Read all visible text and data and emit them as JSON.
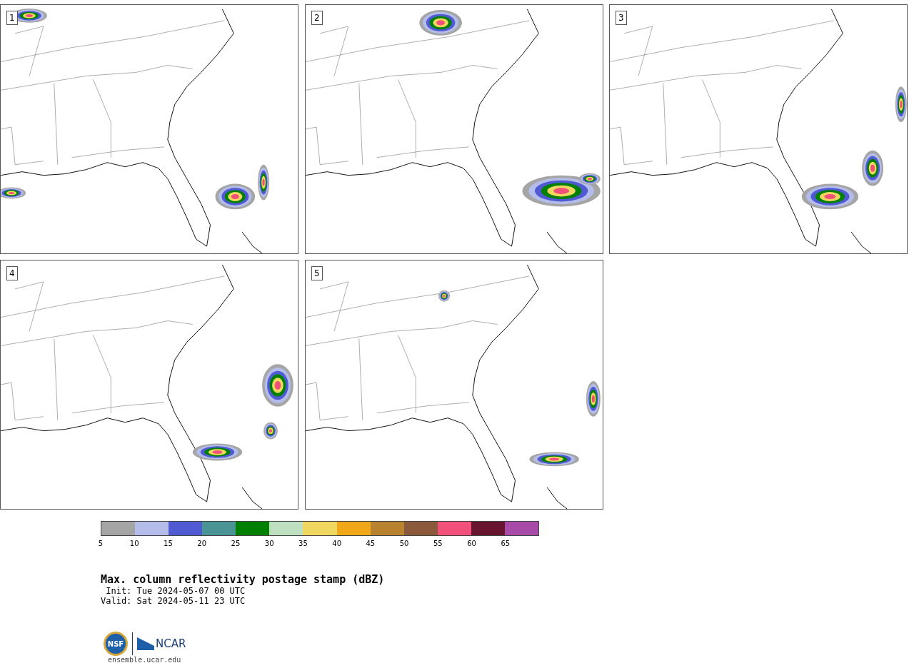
{
  "panels": [
    {
      "label": "1"
    },
    {
      "label": "2"
    },
    {
      "label": "3"
    },
    {
      "label": "4"
    },
    {
      "label": "5"
    }
  ],
  "colorbar": [
    {
      "tick": "5",
      "color": "#a5a5a5"
    },
    {
      "tick": "10",
      "color": "#b4bdea"
    },
    {
      "tick": "15",
      "color": "#505ad2"
    },
    {
      "tick": "20",
      "color": "#4a9496"
    },
    {
      "tick": "25",
      "color": "#008000"
    },
    {
      "tick": "30",
      "color": "#bfe0c0"
    },
    {
      "tick": "35",
      "color": "#f0d860"
    },
    {
      "tick": "40",
      "color": "#f0a818"
    },
    {
      "tick": "45",
      "color": "#b8822e"
    },
    {
      "tick": "50",
      "color": "#8b5a3c"
    },
    {
      "tick": "55",
      "color": "#f0507a"
    },
    {
      "tick": "60",
      "color": "#6a1530"
    },
    {
      "tick": "65",
      "color": "#a84aa8"
    }
  ],
  "title": "Max. column reflectivity postage stamp (dBZ)",
  "init": " Init: Tue 2024-05-07 00 UTC",
  "valid": "Valid: Sat 2024-05-11 23 UTC",
  "logo": {
    "seal": "NSF",
    "name": "NCAR"
  },
  "url": "ensemble.ucar.edu"
}
